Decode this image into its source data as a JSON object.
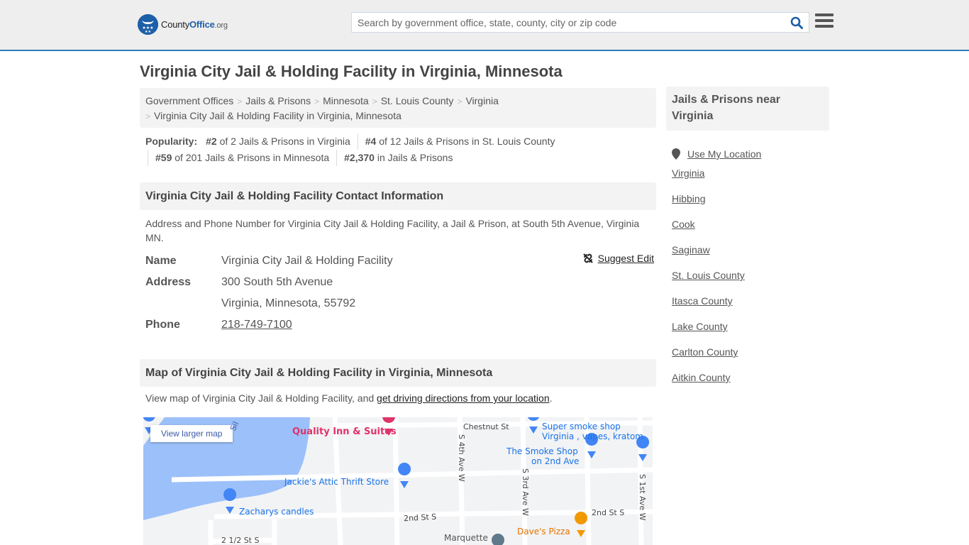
{
  "header": {
    "logo": {
      "brand_plain": "County",
      "brand_bold": "Office",
      "tld": ".org"
    },
    "search": {
      "placeholder": "Search by government office, state, county, city or zip code",
      "value": ""
    },
    "icons": {
      "search": "search-icon",
      "menu": "hamburger-menu-icon"
    }
  },
  "page": {
    "title": "Virginia City Jail & Holding Facility in Virginia, Minnesota"
  },
  "breadcrumb": [
    {
      "label": "Government Offices"
    },
    {
      "label": "Jails & Prisons"
    },
    {
      "label": "Minnesota"
    },
    {
      "label": "St. Louis County"
    },
    {
      "label": "Virginia"
    },
    {
      "label": "Virginia City Jail & Holding Facility in Virginia, Minnesota"
    }
  ],
  "popularity": {
    "label": "Popularity:",
    "items": [
      {
        "rank": "#2",
        "text": " of 2 Jails & Prisons in Virginia"
      },
      {
        "rank": "#4",
        "text": " of 12 Jails & Prisons in St. Louis County"
      },
      {
        "rank": "#59",
        "text": " of 201 Jails & Prisons in Minnesota"
      },
      {
        "rank": "#2,370",
        "text": " in Jails & Prisons"
      }
    ]
  },
  "contact": {
    "heading": "Virginia City Jail & Holding Facility Contact Information",
    "description": "Address and Phone Number for Virginia City Jail & Holding Facility, a Jail & Prison, at South 5th Avenue, Virginia MN.",
    "suggest_edit": "Suggest Edit",
    "fields": {
      "name_label": "Name",
      "name_value": "Virginia City Jail & Holding Facility",
      "address_label": "Address",
      "address_line1": "300 South 5th Avenue",
      "address_line2": "Virginia, Minnesota, 55792",
      "phone_label": "Phone",
      "phone_value": "218-749-7100"
    }
  },
  "map_section": {
    "heading": "Map of Virginia City Jail & Holding Facility in Virginia, Minnesota",
    "desc_prefix": "View map of Virginia City Jail & Holding Facility, and ",
    "desc_link": "get driving directions from your location",
    "desc_suffix": ".",
    "view_larger": "View larger map",
    "labels": {
      "quality_inn": "Quality Inn & Suites",
      "chestnut": "Chestnut St",
      "super_smoke_1": "Super smoke shop",
      "super_smoke_2": "Virginia , vapes, kratom",
      "smoke_shop_1": "The Smoke Shop",
      "smoke_shop_2": "on 2nd Ave",
      "jackies": "Jackie's Attic Thrift Store",
      "zacharys": "Zacharys candles",
      "s4th": "S 4th Ave W",
      "s3rd": "S 3rd Ave W",
      "s1st": "S 1st Ave W",
      "second_st_a": "2nd St S",
      "second_st_b": "2nd St S",
      "two_half": "2 1/2 St S",
      "daves": "Dave's Pizza",
      "marquette": "Marquette",
      "silver": "Sil"
    },
    "colors": {
      "water": "#9cc0f9",
      "poi_blue": "#4285f4",
      "hotel_pink": "#e0336a",
      "food_orange": "#f29900",
      "label_blue": "#1a73e8"
    }
  },
  "sidebar": {
    "heading": "Jails & Prisons near Virginia",
    "use_location": "Use My Location",
    "links": [
      "Virginia",
      "Hibbing",
      "Cook",
      "Saginaw",
      "St. Louis County",
      "Itasca County",
      "Lake County",
      "Carlton County",
      "Aitkin County"
    ]
  }
}
